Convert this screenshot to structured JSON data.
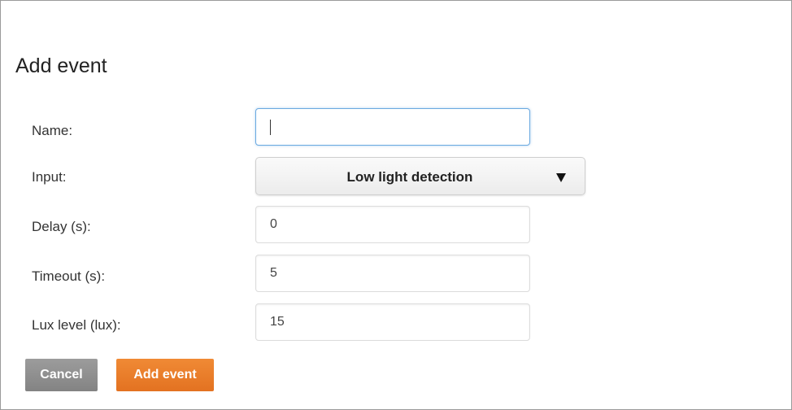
{
  "dialog": {
    "title": "Add event"
  },
  "form": {
    "name": {
      "label": "Name:",
      "value": ""
    },
    "input": {
      "label": "Input:",
      "selected": "Low light detection"
    },
    "delay": {
      "label": "Delay (s):",
      "value": "0"
    },
    "timeout": {
      "label": "Timeout (s):",
      "value": "5"
    },
    "lux": {
      "label": "Lux level (lux):",
      "value": "15"
    }
  },
  "buttons": {
    "cancel": "Cancel",
    "add": "Add event"
  },
  "colors": {
    "accent": "#e8792a",
    "cancel": "#8f8f8f",
    "focus": "#6aa9e0"
  },
  "icons": {
    "select_arrow": "triangle-down-icon"
  }
}
